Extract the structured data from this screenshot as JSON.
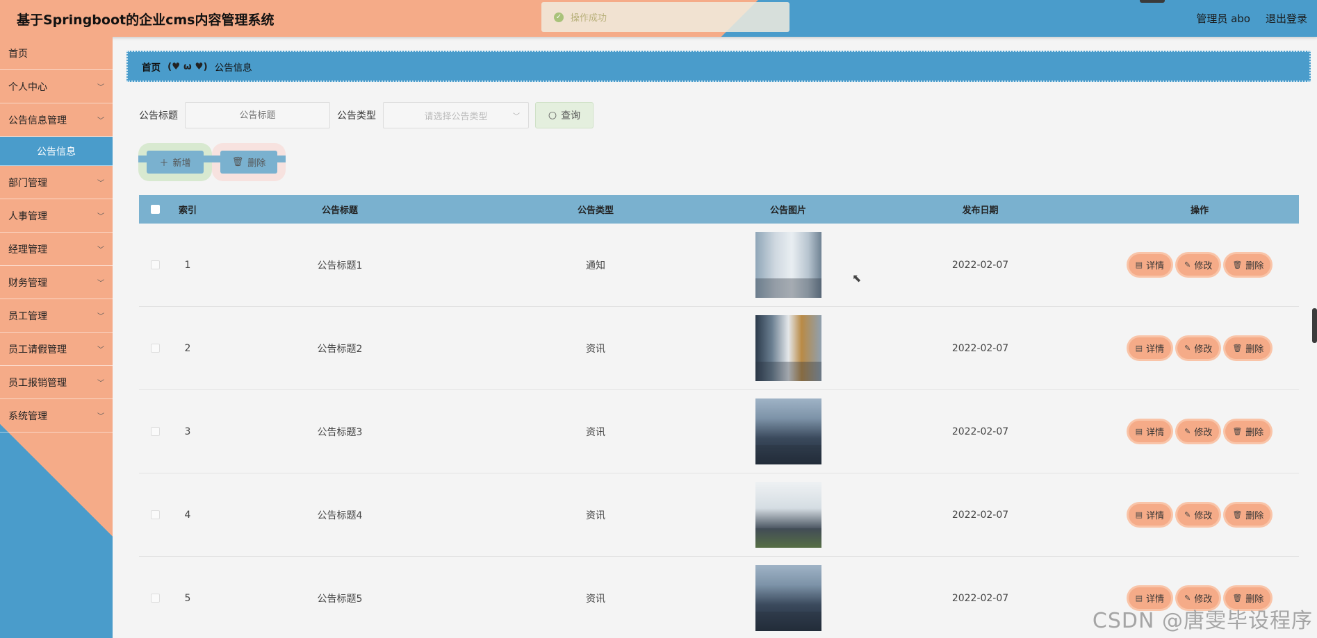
{
  "header": {
    "title": "基于Springboot的企业cms内容管理系统",
    "user": "管理员 abo",
    "logout": "退出登录"
  },
  "toast": {
    "message": "操作成功"
  },
  "sidebar": {
    "items": [
      {
        "label": "首页",
        "chevron": false
      },
      {
        "label": "个人中心",
        "chevron": true
      },
      {
        "label": "公告信息管理",
        "chevron": true
      },
      {
        "label": "公告信息",
        "sub": true
      },
      {
        "label": "部门管理",
        "chevron": true
      },
      {
        "label": "人事管理",
        "chevron": true
      },
      {
        "label": "经理管理",
        "chevron": true
      },
      {
        "label": "财务管理",
        "chevron": true
      },
      {
        "label": "员工管理",
        "chevron": true
      },
      {
        "label": "员工请假管理",
        "chevron": true
      },
      {
        "label": "员工报销管理",
        "chevron": true
      },
      {
        "label": "系统管理",
        "chevron": true
      }
    ]
  },
  "breadcrumb": {
    "home": "首页",
    "separator": "(♥ ω ♥)",
    "current": "公告信息"
  },
  "search": {
    "title_label": "公告标题",
    "title_placeholder": "公告标题",
    "type_label": "公告类型",
    "type_placeholder": "请选择公告类型",
    "query_label": "查询"
  },
  "actions": {
    "add_label": "新增",
    "delete_label": "删除"
  },
  "table": {
    "columns": [
      "索引",
      "公告标题",
      "公告类型",
      "公告图片",
      "发布日期",
      "操作"
    ],
    "rows": [
      {
        "index": "1",
        "title": "公告标题1",
        "type": "通知",
        "image": "office",
        "date": "2022-02-07"
      },
      {
        "index": "2",
        "title": "公告标题2",
        "type": "资讯",
        "image": "office2",
        "date": "2022-02-07"
      },
      {
        "index": "3",
        "title": "公告标题3",
        "type": "资讯",
        "image": "crowd",
        "date": "2022-02-07"
      },
      {
        "index": "4",
        "title": "公告标题4",
        "type": "资讯",
        "image": "crowd2",
        "date": "2022-02-07"
      },
      {
        "index": "5",
        "title": "公告标题5",
        "type": "资讯",
        "image": "crowd",
        "date": "2022-02-07"
      }
    ],
    "row_actions": {
      "detail": "详情",
      "edit": "修改",
      "delete": "删除"
    }
  },
  "watermark": "CSDN @唐雯毕设程序",
  "colors": {
    "orange": "#f5ab88",
    "blue": "#4a9ccb",
    "table_header": "#7ab1cf"
  }
}
